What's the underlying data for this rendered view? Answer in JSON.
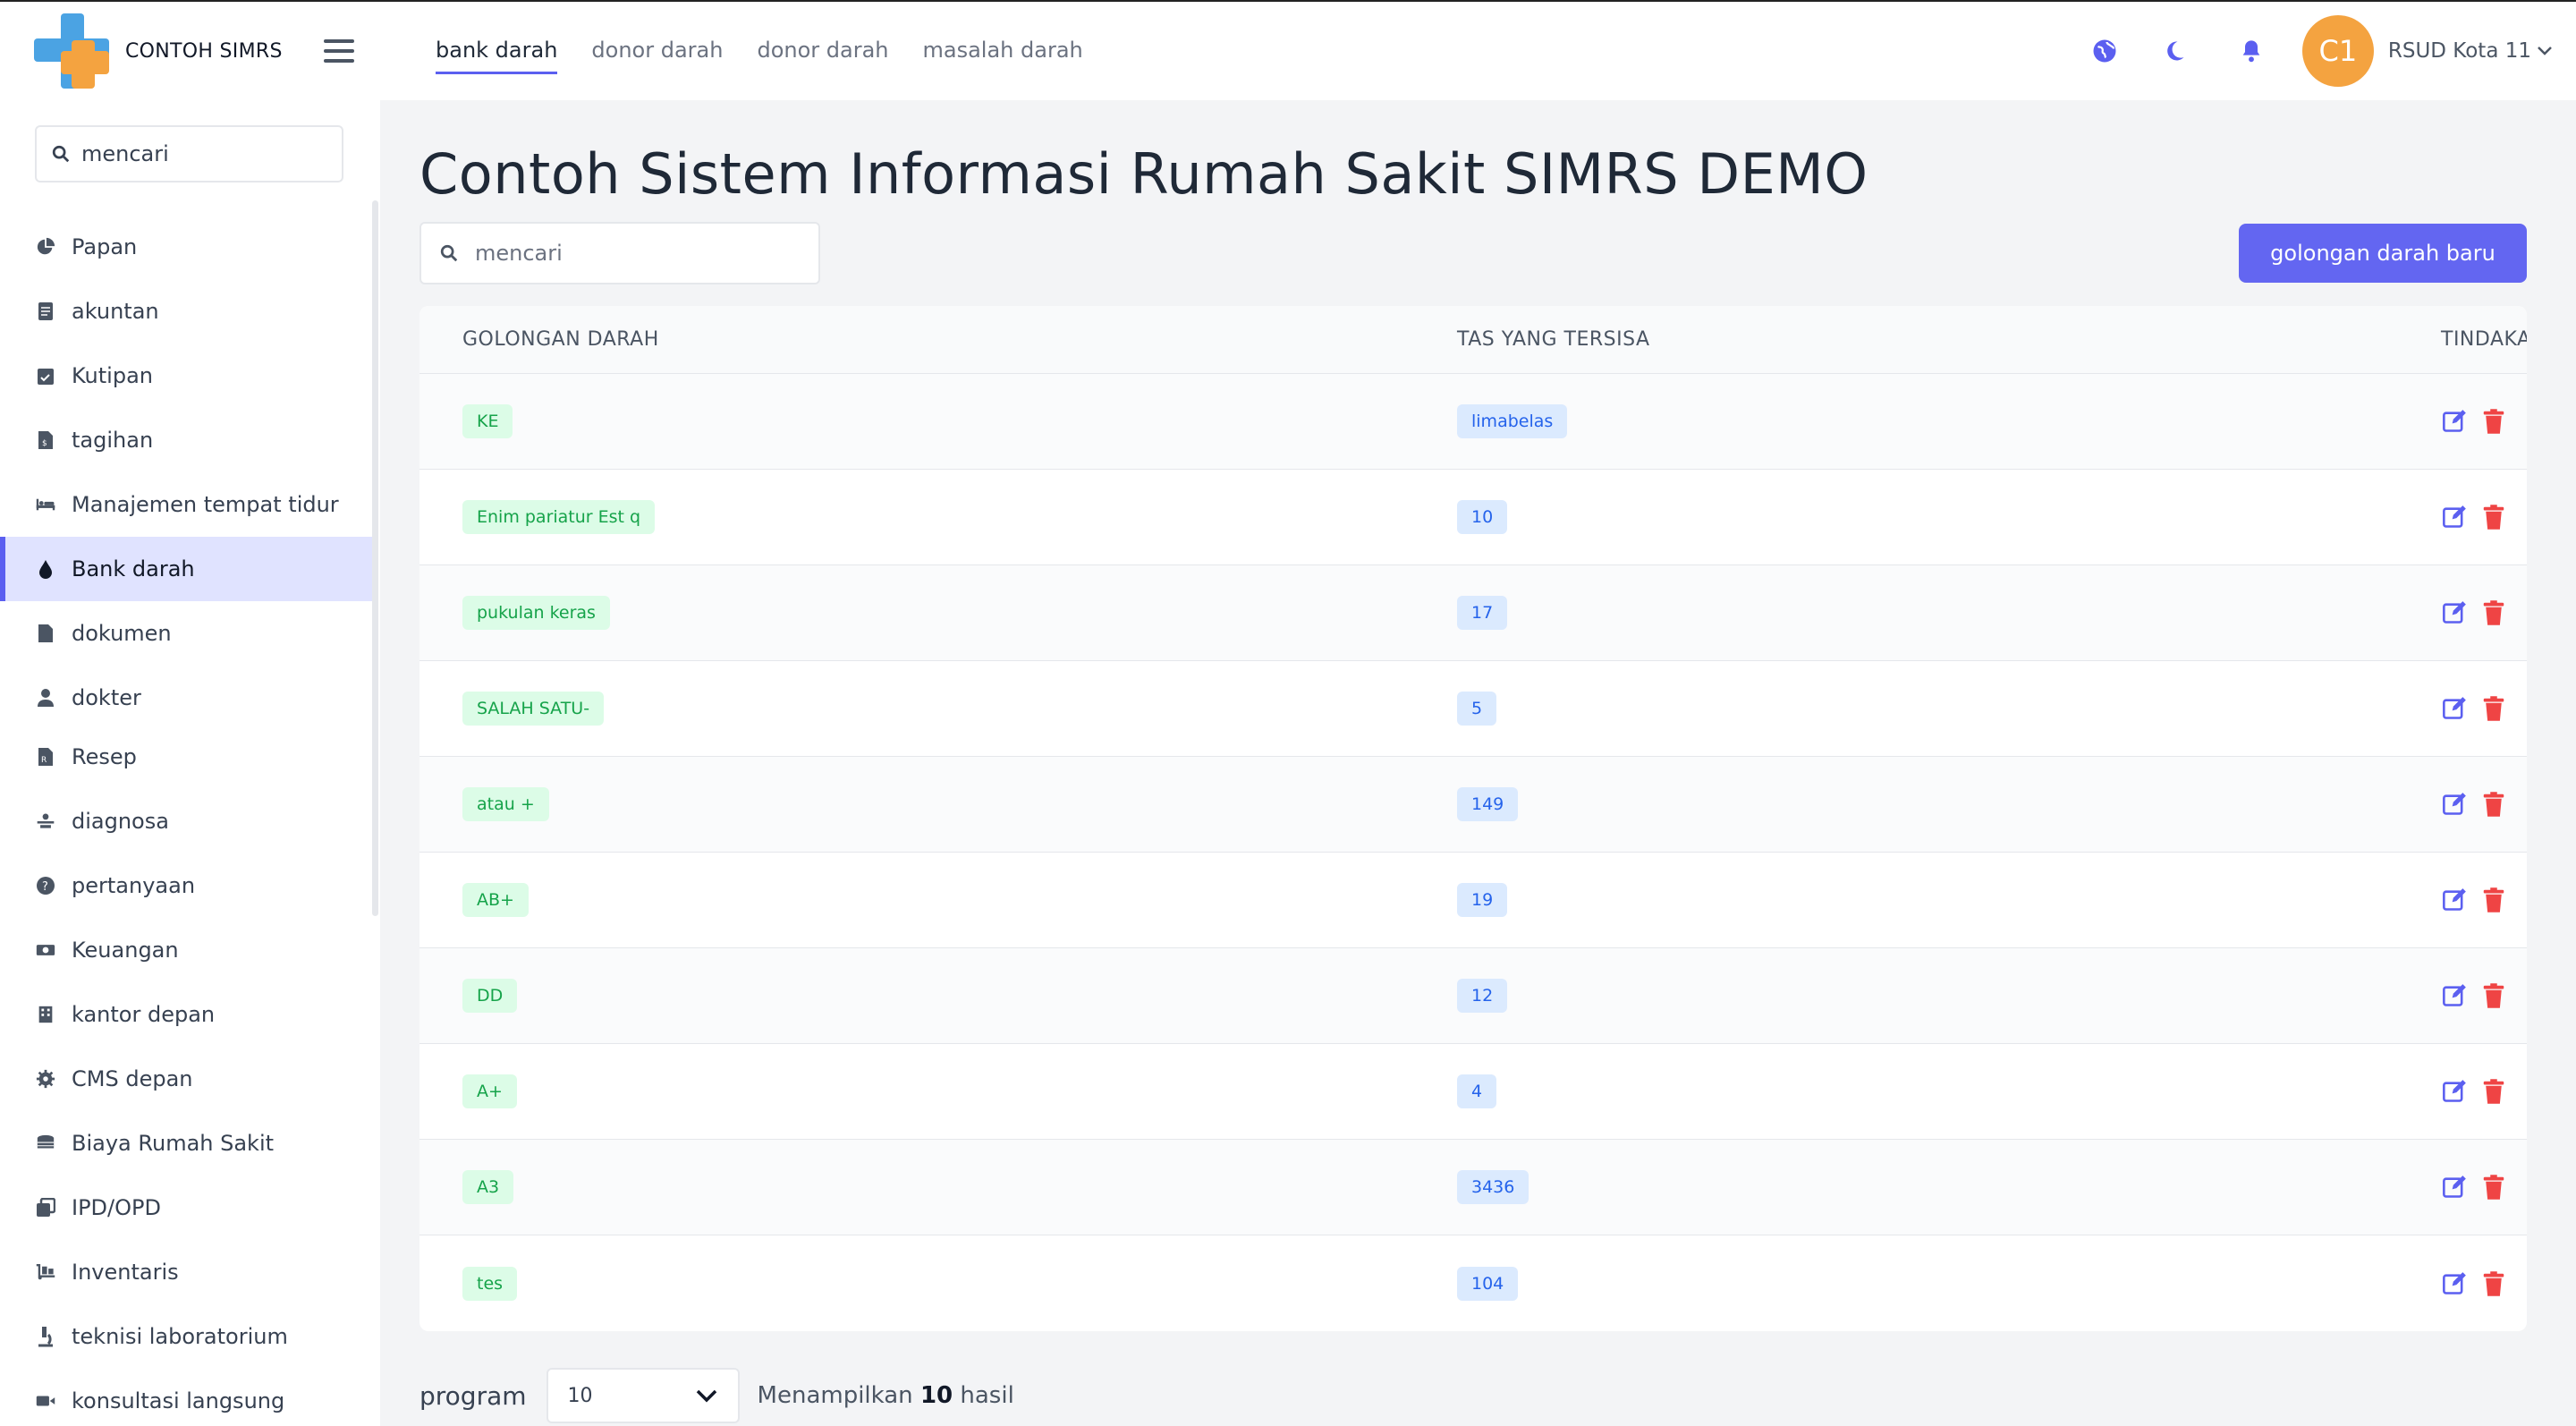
{
  "app": {
    "brand": "CONTOH SIMRS",
    "user_name": "RSUD Kota 11",
    "avatar_initials": "C1",
    "accent": "#6366f1"
  },
  "topnav": [
    {
      "label": "bank darah",
      "active": true
    },
    {
      "label": "donor darah",
      "active": false
    },
    {
      "label": "donor darah",
      "active": false
    },
    {
      "label": "masalah darah",
      "active": false
    }
  ],
  "topbar_icons": [
    "globe-icon",
    "moon-icon",
    "bell-icon"
  ],
  "sidebar": {
    "search_placeholder": "mencari",
    "items": [
      {
        "label": "Papan",
        "icon": "chart-pie-icon"
      },
      {
        "label": "akuntan",
        "icon": "document-icon"
      },
      {
        "label": "Kutipan",
        "icon": "calendar-check-icon"
      },
      {
        "label": "tagihan",
        "icon": "invoice-icon"
      },
      {
        "label": "Manajemen tempat tidur",
        "icon": "bed-icon"
      },
      {
        "label": "Bank darah",
        "icon": "drop-icon",
        "active": true
      },
      {
        "label": "dokumen",
        "icon": "file-icon"
      },
      {
        "label": "dokter",
        "icon": "doctor-icon"
      },
      {
        "label": "Resep",
        "icon": "prescription-icon"
      },
      {
        "label": "diagnosa",
        "icon": "diagnosis-icon"
      },
      {
        "label": "pertanyaan",
        "icon": "question-icon"
      },
      {
        "label": "Keuangan",
        "icon": "money-icon"
      },
      {
        "label": "kantor depan",
        "icon": "building-icon"
      },
      {
        "label": "CMS depan",
        "icon": "cog-icon"
      },
      {
        "label": "Biaya Rumah Sakit",
        "icon": "coins-icon"
      },
      {
        "label": "IPD/OPD",
        "icon": "clone-icon"
      },
      {
        "label": "Inventaris",
        "icon": "dolly-icon"
      },
      {
        "label": "teknisi laboratorium",
        "icon": "microscope-icon"
      },
      {
        "label": "konsultasi langsung",
        "icon": "video-icon"
      }
    ]
  },
  "main": {
    "title": "Contoh Sistem Informasi Rumah Sakit SIMRS DEMO",
    "search_placeholder": "mencari",
    "new_button": "golongan darah baru",
    "table": {
      "headers": [
        "GOLONGAN DARAH",
        "TAS YANG TERSISA",
        "TINDAKAN"
      ],
      "rows": [
        {
          "group": "KE",
          "remaining": "limabelas"
        },
        {
          "group": "Enim pariatur Est q",
          "remaining": "10"
        },
        {
          "group": "pukulan keras",
          "remaining": "17"
        },
        {
          "group": "SALAH SATU-",
          "remaining": "5"
        },
        {
          "group": "atau +",
          "remaining": "149"
        },
        {
          "group": "AB+",
          "remaining": "19"
        },
        {
          "group": "DD",
          "remaining": "12"
        },
        {
          "group": "A+",
          "remaining": "4"
        },
        {
          "group": "A3",
          "remaining": "3436"
        },
        {
          "group": "tes",
          "remaining": "104"
        }
      ]
    },
    "pager": {
      "label": "program",
      "per_page": "10",
      "info_prefix": "Menampilkan",
      "info_count": "10",
      "info_suffix": "hasil"
    }
  }
}
